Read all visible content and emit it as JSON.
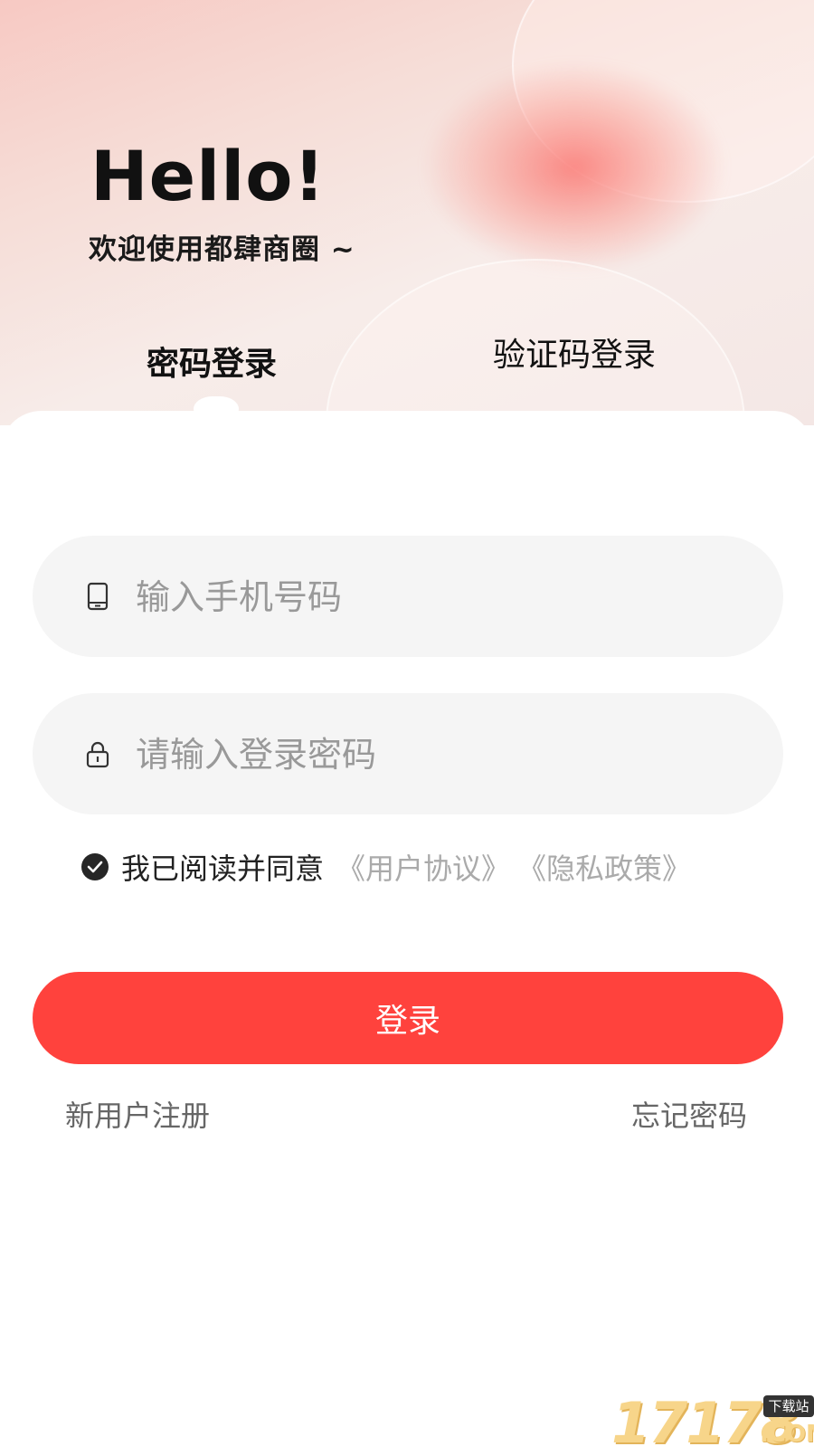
{
  "header": {
    "greeting": "Hello!",
    "welcome": "欢迎使用都肆商圈 ~"
  },
  "tabs": [
    {
      "label": "密码登录",
      "active": true
    },
    {
      "label": "验证码登录",
      "active": false
    }
  ],
  "form": {
    "phone_placeholder": "输入手机号码",
    "password_placeholder": "请输入登录密码",
    "phone_icon": "phone-icon",
    "lock_icon": "lock-icon"
  },
  "agreement": {
    "checked": true,
    "text": "我已阅读并同意",
    "user_agreement": "《用户协议》",
    "privacy_policy": "《隐私政策》"
  },
  "login_button": "登录",
  "footer": {
    "register": "新用户注册",
    "forgot": "忘记密码"
  },
  "watermark": {
    "number": "17178",
    "badge": "下载站",
    "suffix": ".COM"
  },
  "colors": {
    "accent": "#ff423d",
    "field_bg": "#f5f5f5",
    "link": "#aaaaaa"
  }
}
